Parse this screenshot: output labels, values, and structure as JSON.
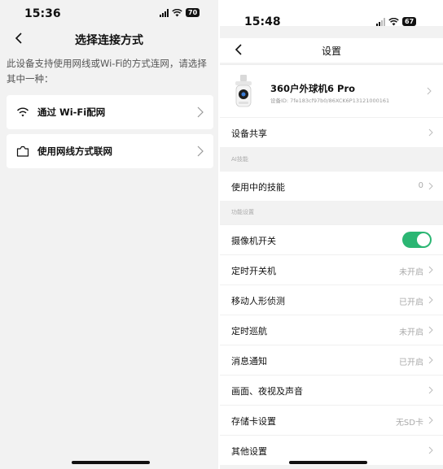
{
  "left": {
    "status": {
      "time": "15:36",
      "battery": "70"
    },
    "title": "选择连接方式",
    "description": "此设备支持使用网线或Wi-Fi的方式连网，请选择其中一种：",
    "options": [
      {
        "label": "通过 Wi-Fi配网",
        "icon": "wifi-icon"
      },
      {
        "label": "使用网线方式联网",
        "icon": "ethernet-icon"
      }
    ]
  },
  "right": {
    "status": {
      "time": "15:48",
      "battery": "67"
    },
    "title": "设置",
    "device": {
      "name": "360户外球机6 Pro",
      "id": "设备ID: 7fe183cf97b0/86XCK6P13121000161"
    },
    "share_label": "设备共享",
    "sections": {
      "ai": "AI技能",
      "features": "功能设置"
    },
    "skills": {
      "label": "使用中的技能",
      "value": "0"
    },
    "camera_switch": {
      "label": "摄像机开关",
      "on": true
    },
    "rows": [
      {
        "label": "定时开关机",
        "value": "未开启"
      },
      {
        "label": "移动人形侦测",
        "value": "已开启"
      },
      {
        "label": "定时巡航",
        "value": "未开启"
      },
      {
        "label": "消息通知",
        "value": "已开启"
      },
      {
        "label": "画面、夜视及声音",
        "value": ""
      },
      {
        "label": "存储卡设置",
        "value": "无SD卡"
      },
      {
        "label": "其他设置",
        "value": ""
      }
    ],
    "accent_color": "#2bb673"
  }
}
